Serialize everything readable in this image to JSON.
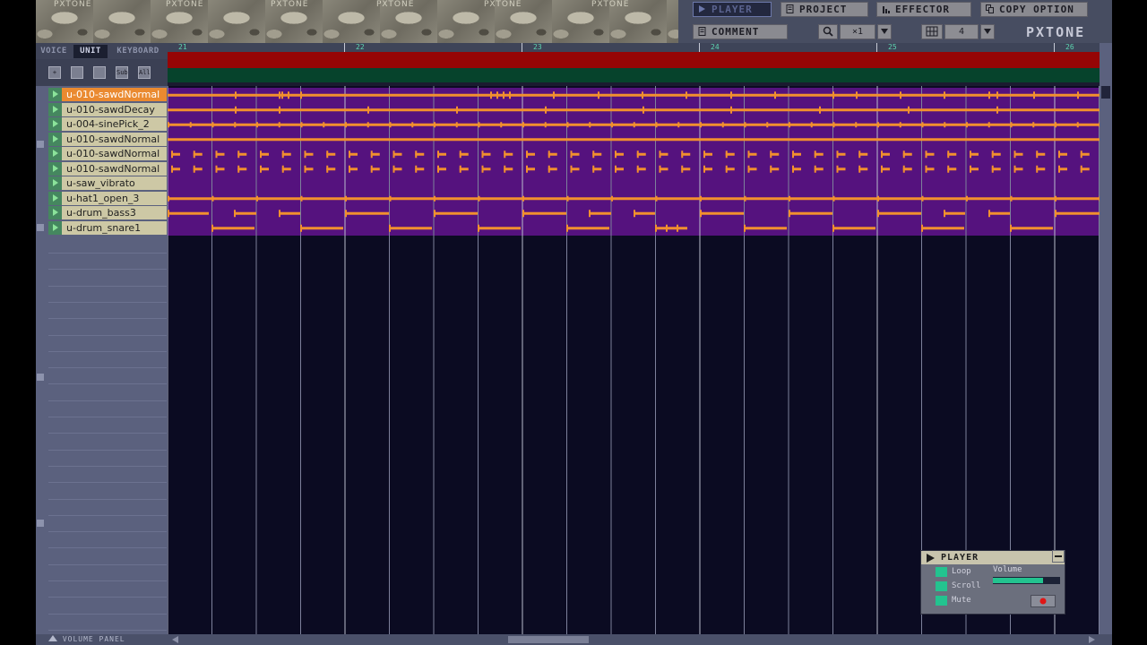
{
  "banner": {
    "text": "PXTONE"
  },
  "menu": [
    {
      "label": "PLAYER",
      "active": true,
      "icon": "play-icon"
    },
    {
      "label": "PROJECT",
      "active": false,
      "icon": "document-icon"
    },
    {
      "label": "EFFECTOR",
      "active": false,
      "icon": "equalizer-icon"
    },
    {
      "label": "COPY OPTION",
      "active": false,
      "icon": "copy-icon"
    },
    {
      "label": "COMMENT",
      "active": false,
      "icon": "document-icon"
    }
  ],
  "zoom": {
    "value": "×1",
    "icon": "magnifier-icon"
  },
  "division": {
    "value": "4",
    "icon": "division-icon"
  },
  "logo": "PXTONE",
  "tabs": [
    {
      "label": "VOICE",
      "active": false
    },
    {
      "label": "UNIT",
      "active": true
    },
    {
      "label": "KEYBOARD",
      "active": false
    }
  ],
  "tools": [
    "+",
    "",
    "",
    "Sub",
    "All"
  ],
  "units": [
    {
      "name": "u-010-sawdNormal",
      "selected": true
    },
    {
      "name": "u-010-sawdDecay",
      "selected": false
    },
    {
      "name": "u-004-sinePick_2",
      "selected": false
    },
    {
      "name": "u-010-sawdNormal",
      "selected": false
    },
    {
      "name": "u-010-sawdNormal",
      "selected": false
    },
    {
      "name": "u-010-sawdNormal",
      "selected": false
    },
    {
      "name": "u-saw_vibrato",
      "selected": false
    },
    {
      "name": "u-hat1_open_3",
      "selected": false
    },
    {
      "name": "u-drum_bass3",
      "selected": false
    },
    {
      "name": "u-drum_snare1",
      "selected": false
    }
  ],
  "measures": [
    "21",
    "22",
    "23",
    "24",
    "25",
    "26"
  ],
  "volume_panel": "VOLUME PANEL",
  "player": {
    "title": "PLAYER",
    "options": [
      {
        "label": "Loop",
        "checked": true
      },
      {
        "label": "Scroll",
        "checked": true
      },
      {
        "label": "Mute",
        "checked": true
      }
    ],
    "volume_label": "Volume",
    "volume": 0.75
  },
  "colors": {
    "note": "#f2902e",
    "track_bg": "#55127e",
    "measure_strip": "#960505",
    "selected_unit": "#ea8a30",
    "accent_green": "#23c38f"
  }
}
